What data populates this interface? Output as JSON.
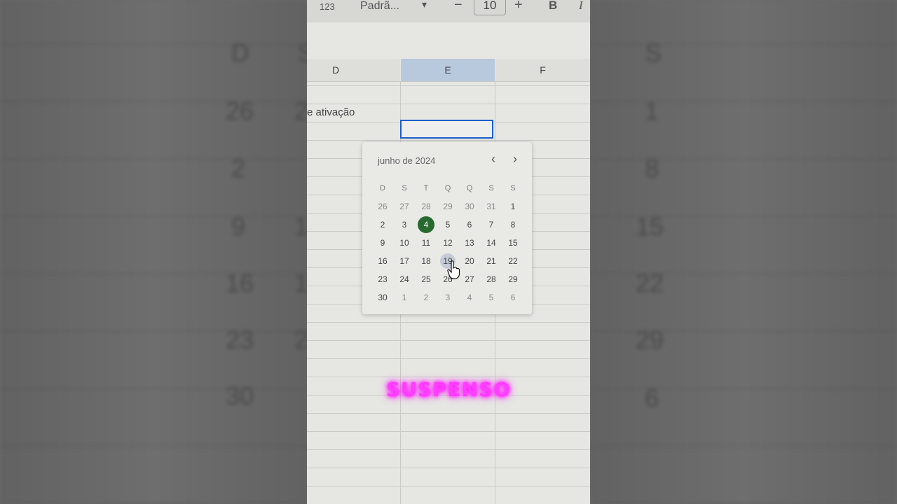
{
  "toolbar": {
    "format_123": "123",
    "font_name": "Padrã...",
    "decrease": "−",
    "font_size": "10",
    "increase": "+",
    "bold": "B",
    "italic": "I"
  },
  "columns": {
    "d": "D",
    "e": "E",
    "f": "F"
  },
  "cell_label": "e ativação",
  "datepicker": {
    "month_label": "junho de 2024",
    "prev": "‹",
    "next": "›",
    "weekdays": [
      "D",
      "S",
      "T",
      "Q",
      "Q",
      "S",
      "S"
    ],
    "weeks": [
      [
        "26",
        "27",
        "28",
        "29",
        "30",
        "31",
        "1"
      ],
      [
        "2",
        "3",
        "4",
        "5",
        "6",
        "7",
        "8"
      ],
      [
        "9",
        "10",
        "11",
        "12",
        "13",
        "14",
        "15"
      ],
      [
        "16",
        "17",
        "18",
        "19",
        "20",
        "21",
        "22"
      ],
      [
        "23",
        "24",
        "25",
        "26",
        "27",
        "28",
        "29"
      ],
      [
        "30",
        "1",
        "2",
        "3",
        "4",
        "5",
        "6"
      ]
    ],
    "selected_day": "4",
    "hover_day": "19"
  },
  "overlay_text": "SUSPENSO",
  "background_left": {
    "col_letters": [
      "D",
      "S"
    ],
    "numbers": [
      "26",
      "2",
      "9",
      "16",
      "23",
      "30"
    ],
    "partial": [
      "2",
      "1",
      "1",
      "2"
    ]
  },
  "background_right": {
    "col_letters": [
      "S"
    ],
    "numbers": [
      "1",
      "8",
      "15",
      "22",
      "29",
      "6"
    ]
  },
  "colors": {
    "selected_day": "#27692f",
    "active_border": "#1a5fc9",
    "overlay": "#ff3cff"
  }
}
